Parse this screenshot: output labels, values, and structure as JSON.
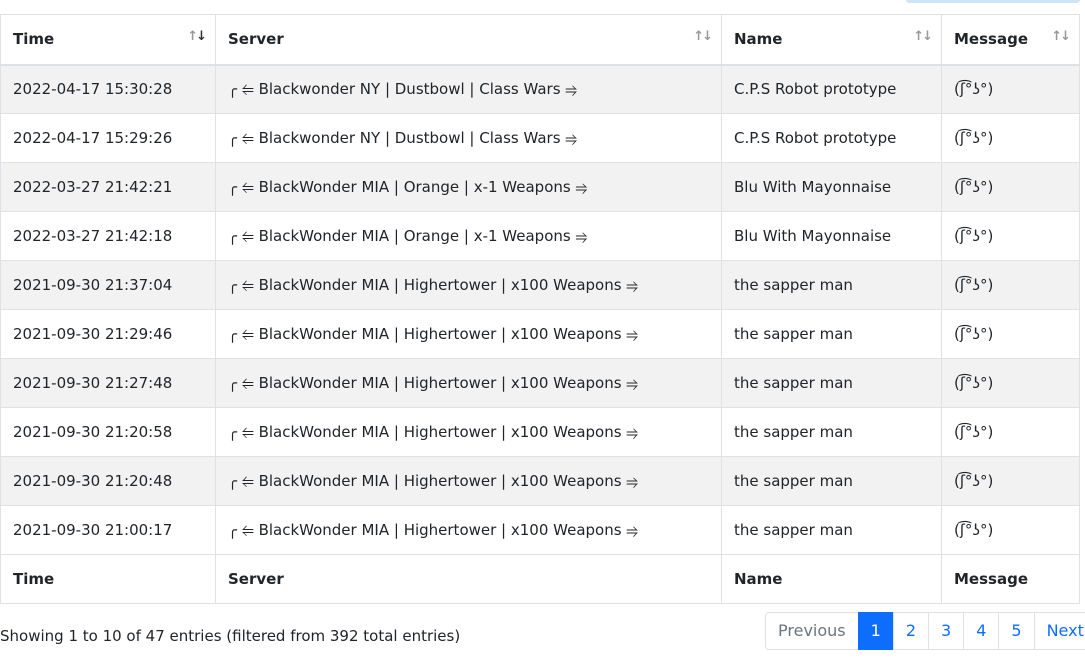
{
  "table": {
    "headers": [
      "Time",
      "Server",
      "Name",
      "Message"
    ],
    "footers": [
      "Time",
      "Server",
      "Name",
      "Message"
    ],
    "rows": [
      {
        "time": "2022-04-17 15:30:28",
        "server": "╭ ⥢ Blackwonder NY | Dustbowl | Class Wars ⥤",
        "name": "C.P.S Robot prototype",
        "message": "(ʃ͡°ʖ°)"
      },
      {
        "time": "2022-04-17 15:29:26",
        "server": "╭ ⥢ Blackwonder NY | Dustbowl | Class Wars ⥤",
        "name": "C.P.S Robot prototype",
        "message": "(ʃ͡°ʖ°)"
      },
      {
        "time": "2022-03-27 21:42:21",
        "server": "╭ ⥢ BlackWonder MIA | Orange | x-1 Weapons ⥤",
        "name": "Blu With Mayonnaise",
        "message": "(ʃ͡°ʖ°)"
      },
      {
        "time": "2022-03-27 21:42:18",
        "server": "╭ ⥢ BlackWonder MIA | Orange | x-1 Weapons ⥤",
        "name": "Blu With Mayonnaise",
        "message": "(ʃ͡°ʖ°)"
      },
      {
        "time": "2021-09-30 21:37:04",
        "server": "╭ ⥢ BlackWonder MIA | Highertower | x100 Weapons ⥤",
        "name": "the sapper man",
        "message": "(ʃ͡°ʖ°)"
      },
      {
        "time": "2021-09-30 21:29:46",
        "server": "╭ ⥢ BlackWonder MIA | Highertower | x100 Weapons ⥤",
        "name": "the sapper man",
        "message": "(ʃ͡°ʖ°)"
      },
      {
        "time": "2021-09-30 21:27:48",
        "server": "╭ ⥢ BlackWonder MIA | Highertower | x100 Weapons ⥤",
        "name": "the sapper man",
        "message": "(ʃ͡°ʖ°)"
      },
      {
        "time": "2021-09-30 21:20:58",
        "server": "╭ ⥢ BlackWonder MIA | Highertower | x100 Weapons ⥤",
        "name": "the sapper man",
        "message": "(ʃ͡°ʖ°)"
      },
      {
        "time": "2021-09-30 21:20:48",
        "server": "╭ ⥢ BlackWonder MIA | Highertower | x100 Weapons ⥤",
        "name": "the sapper man",
        "message": "(ʃ͡°ʖ°)"
      },
      {
        "time": "2021-09-30 21:00:17",
        "server": "╭ ⥢ BlackWonder MIA | Highertower | x100 Weapons ⥤",
        "name": "the sapper man",
        "message": "(ʃ͡°ʖ°)"
      }
    ]
  },
  "info": "Showing 1 to 10 of 47 entries (filtered from 392 total entries)",
  "pagination": {
    "previous": "Previous",
    "pages": [
      "1",
      "2",
      "3",
      "4",
      "5"
    ],
    "next": "Next",
    "active_page": "1"
  },
  "colors": {
    "accent": "#0d6efd",
    "stripe": "#f2f2f2",
    "border": "#dee2e6"
  }
}
